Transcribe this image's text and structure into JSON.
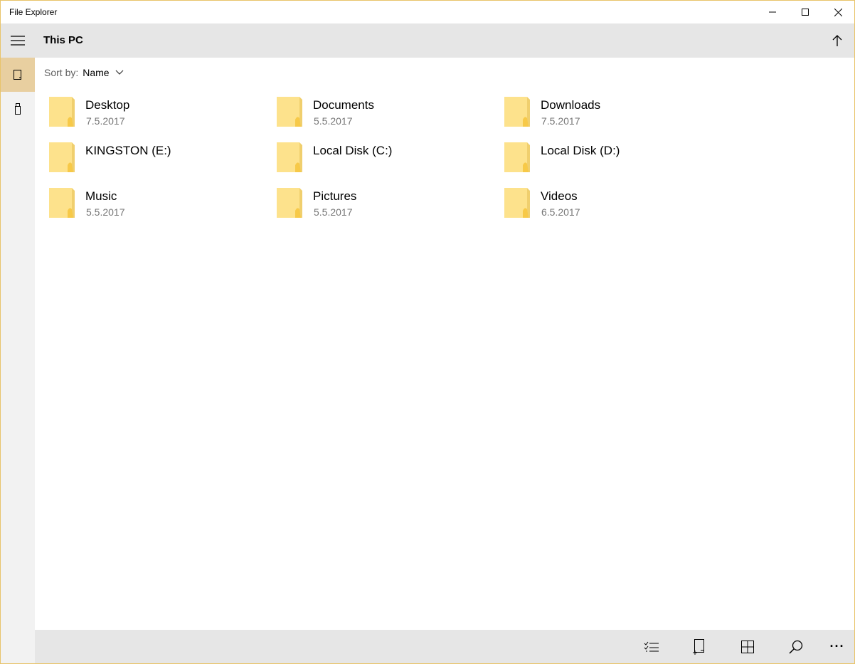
{
  "window": {
    "title": "File Explorer"
  },
  "caption_buttons": {
    "minimize": "minimize-icon",
    "maximize": "maximize-icon",
    "close": "close-icon"
  },
  "nav": {
    "menu_icon": "hamburger-icon",
    "items": [
      {
        "icon": "device-icon",
        "active": true
      },
      {
        "icon": "usb-drive-icon",
        "active": false
      }
    ]
  },
  "header": {
    "title": "This PC",
    "up_icon": "arrow-up-icon"
  },
  "sort": {
    "label": "Sort by:",
    "value": "Name"
  },
  "items": [
    {
      "name": "Desktop",
      "date": "7.5.2017"
    },
    {
      "name": "Documents",
      "date": "5.5.2017"
    },
    {
      "name": "Downloads",
      "date": "7.5.2017"
    },
    {
      "name": "KINGSTON (E:)",
      "date": ""
    },
    {
      "name": "Local Disk (C:)",
      "date": ""
    },
    {
      "name": "Local Disk (D:)",
      "date": ""
    },
    {
      "name": "Music",
      "date": "5.5.2017"
    },
    {
      "name": "Pictures",
      "date": "5.5.2017"
    },
    {
      "name": "Videos",
      "date": "6.5.2017"
    }
  ],
  "commands": {
    "select": "select-list-icon",
    "new_folder": "new-item-icon",
    "view": "grid-view-icon",
    "search": "search-icon",
    "more": "more-icon",
    "more_glyph": "···"
  },
  "colors": {
    "accent_border": "#e8c46a",
    "active_nav": "#e8cfa0",
    "folder_fill": "#fde28c",
    "folder_shade": "#f7c948",
    "bar_bg": "#e6e6e6",
    "rail_bg": "#f2f2f2"
  }
}
